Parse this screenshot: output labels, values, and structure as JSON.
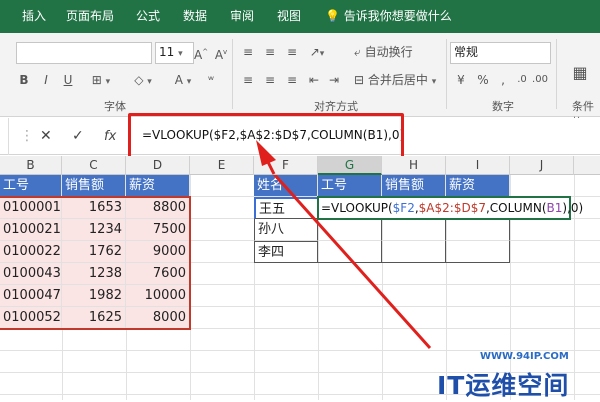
{
  "ribbon_tabs": [
    "插入",
    "页面布局",
    "公式",
    "数据",
    "审阅",
    "视图"
  ],
  "tell_me": "告诉我你想要做什么",
  "font_size": "11",
  "wrap_text": "自动换行",
  "merge_center": "合并后居中",
  "number_format": "常规",
  "group_labels": {
    "font": "字体",
    "alignment": "对齐方式",
    "number": "数字",
    "styles": "条件格"
  },
  "formula_bar": {
    "cancel": "✕",
    "enter": "✓",
    "fx": "fx",
    "content": "=VLOOKUP($F2,$A$2:$D$7,COLUMN(B1),0)"
  },
  "columns": [
    "B",
    "C",
    "D",
    "E",
    "F",
    "G",
    "H",
    "I",
    "J"
  ],
  "left_table": {
    "headers": [
      "工号",
      "销售额",
      "薪资"
    ],
    "rows": [
      [
        "0100001",
        "1653",
        "8800"
      ],
      [
        "0100021",
        "1234",
        "7500"
      ],
      [
        "0100022",
        "1762",
        "9000"
      ],
      [
        "0100043",
        "1238",
        "7600"
      ],
      [
        "0100047",
        "1982",
        "10000"
      ],
      [
        "0100052",
        "1625",
        "8000"
      ]
    ]
  },
  "right_table": {
    "headers": [
      "姓名",
      "工号",
      "销售额",
      "薪资"
    ],
    "names": [
      "王五",
      "孙八",
      "李四"
    ],
    "edit_parts": [
      {
        "t": "=VLOOKUP(",
        "c": "#111111"
      },
      {
        "t": "$F2",
        "c": "#3b6fd6"
      },
      {
        "t": ",",
        "c": "#111111"
      },
      {
        "t": "$A$2:$D$7",
        "c": "#c0392b"
      },
      {
        "t": ",COLUMN(",
        "c": "#111111"
      },
      {
        "t": "B1",
        "c": "#8e44ad"
      },
      {
        "t": "),0)",
        "c": "#111111"
      }
    ]
  },
  "colors": {
    "ribbon": "#217346",
    "header_fill": "#4472c4",
    "lookup_fill": "#fbe4e4",
    "annotation": "#e0201c"
  },
  "watermark": {
    "url": "WWW.94IP.COM",
    "logo": "IT运维空间"
  }
}
